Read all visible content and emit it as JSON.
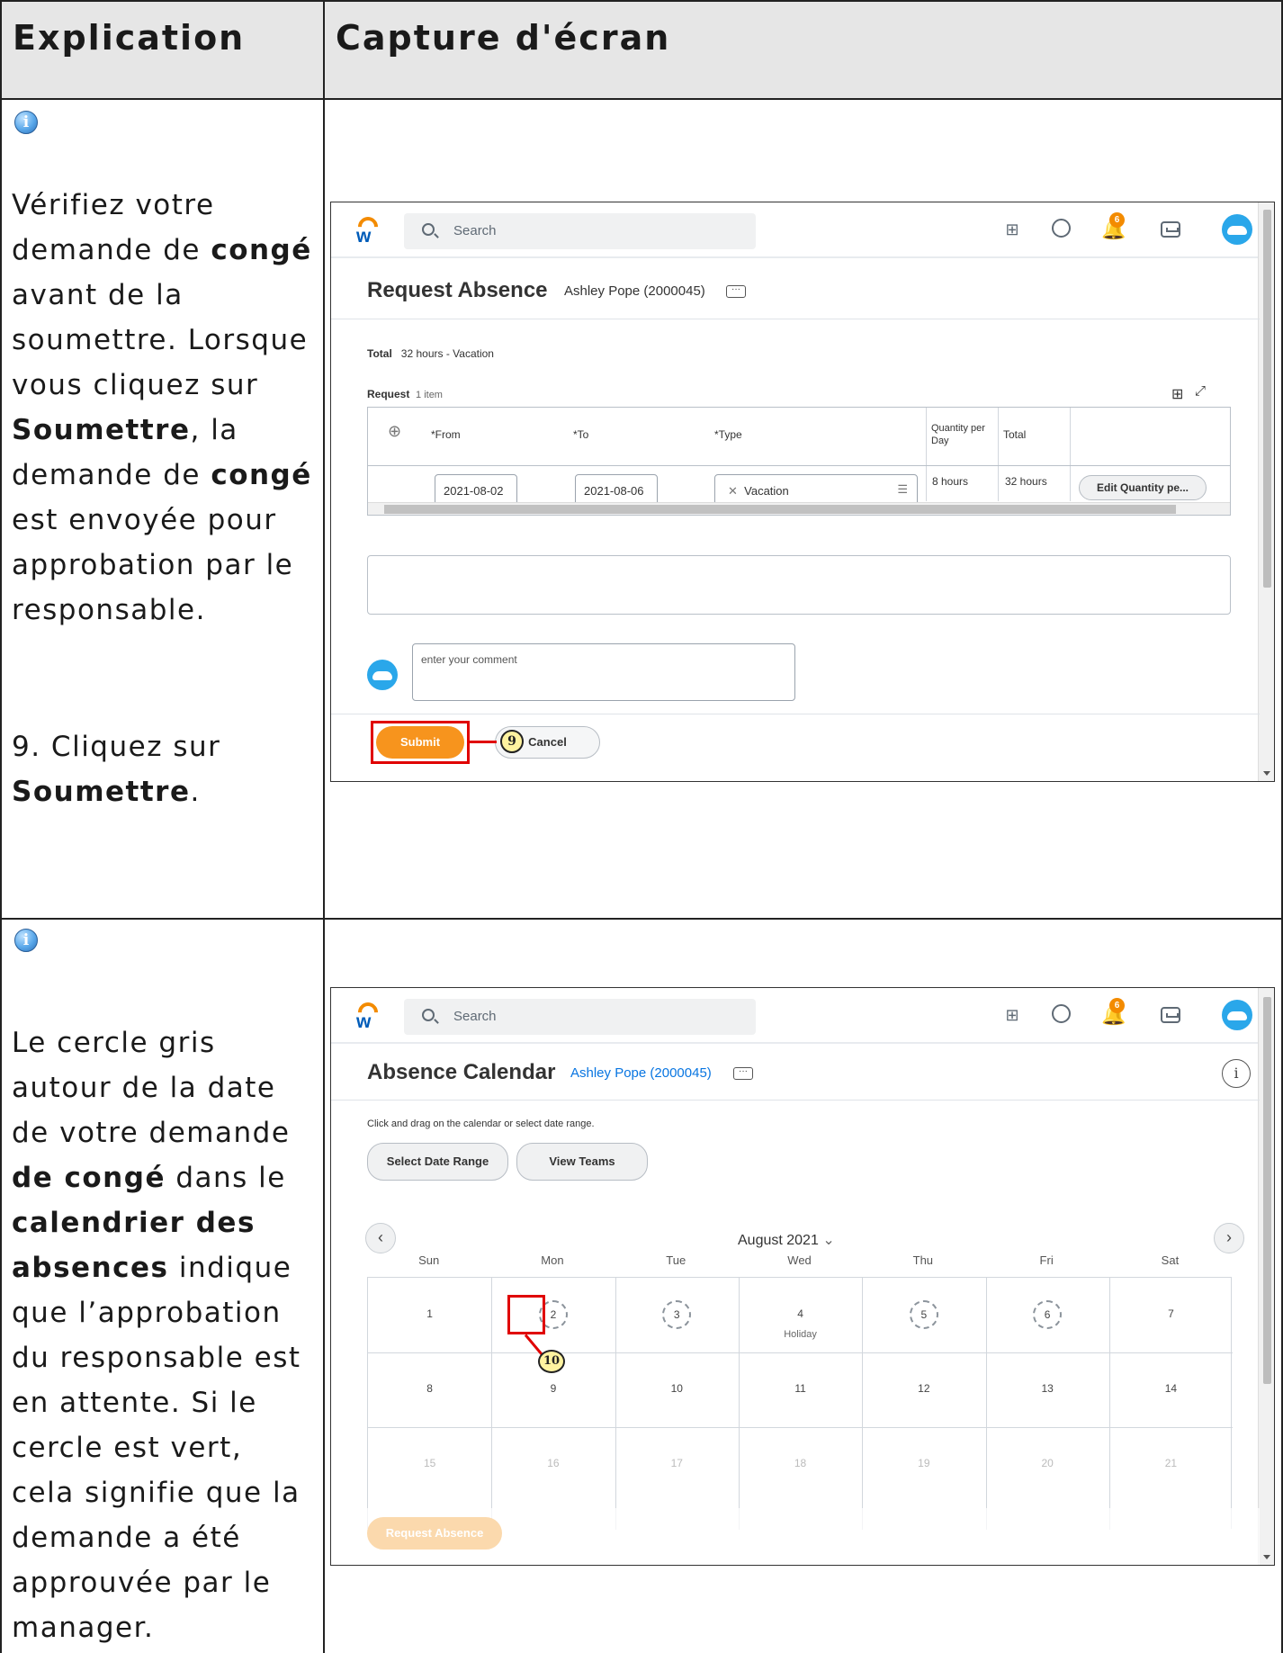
{
  "headers": {
    "col1": "Explication",
    "col2": "Capture d'écran"
  },
  "info_icon_glyph": "i",
  "row1": {
    "explanation": {
      "p1_before": "Vérifiez votre demande de ",
      "p1_bold1": "congé",
      "p1_mid1": " avant de la soumettre. Lorsque vous cliquez sur ",
      "p1_bold2": "Soumettre",
      "p1_mid2": ", la demande de ",
      "p1_bold3": "congé",
      "p1_after": " est envoyée pour approbation par le responsable.",
      "step_prefix": "9. Cliquez sur ",
      "step_bold": "Soumettre",
      "step_suffix": "."
    },
    "screenshot": {
      "search_placeholder": "Search",
      "notification_count": "6",
      "page_title": "Request Absence",
      "worker": "Ashley Pope (2000045)",
      "more_glyph": "···",
      "total_label": "Total",
      "total_value": "32 hours - Vacation",
      "request_label": "Request",
      "request_count": "1 item",
      "columns": {
        "from": "*From",
        "to": "*To",
        "type": "*Type",
        "qty_line1": "Quantity per",
        "qty_line2": "Day",
        "total": "Total"
      },
      "row": {
        "from": "2021-08-02",
        "to": "2021-08-06",
        "type": "Vacation",
        "qty": "8 hours",
        "total": "32 hours",
        "action": "Edit Quantity pe..."
      },
      "comment_placeholder": "enter your comment",
      "submit": "Submit",
      "cancel": "Cancel",
      "callout": "9"
    }
  },
  "row2": {
    "explanation": {
      "p_before": "Le cercle gris autour de la date de votre demande ",
      "p_bold1": "de congé",
      "p_mid1": " dans le ",
      "p_bold2": "calendrier des absences",
      "p_after": " indique que l’approbation du responsable est en attente. Si le cercle est vert, cela signifie que la demande a été approuvée par le manager."
    },
    "screenshot": {
      "search_placeholder": "Search",
      "notification_count": "6",
      "page_title": "Absence Calendar",
      "worker": "Ashley Pope (2000045)",
      "more_glyph": "···",
      "hint": "Click and drag on the calendar or select date range.",
      "select_date_range": "Select Date Range",
      "view_teams": "View Teams",
      "month": "August 2021",
      "weekdays": [
        "Sun",
        "Mon",
        "Tue",
        "Wed",
        "Thu",
        "Fri",
        "Sat"
      ],
      "week1": [
        "1",
        "2",
        "3",
        "4",
        "5",
        "6",
        "7"
      ],
      "holiday_label": "Holiday",
      "week2": [
        "8",
        "9",
        "10",
        "11",
        "12",
        "13",
        "14"
      ],
      "week3": [
        "15",
        "16",
        "17",
        "18",
        "19",
        "20",
        "21"
      ],
      "request_absence": "Request Absence",
      "callout": "10"
    }
  }
}
